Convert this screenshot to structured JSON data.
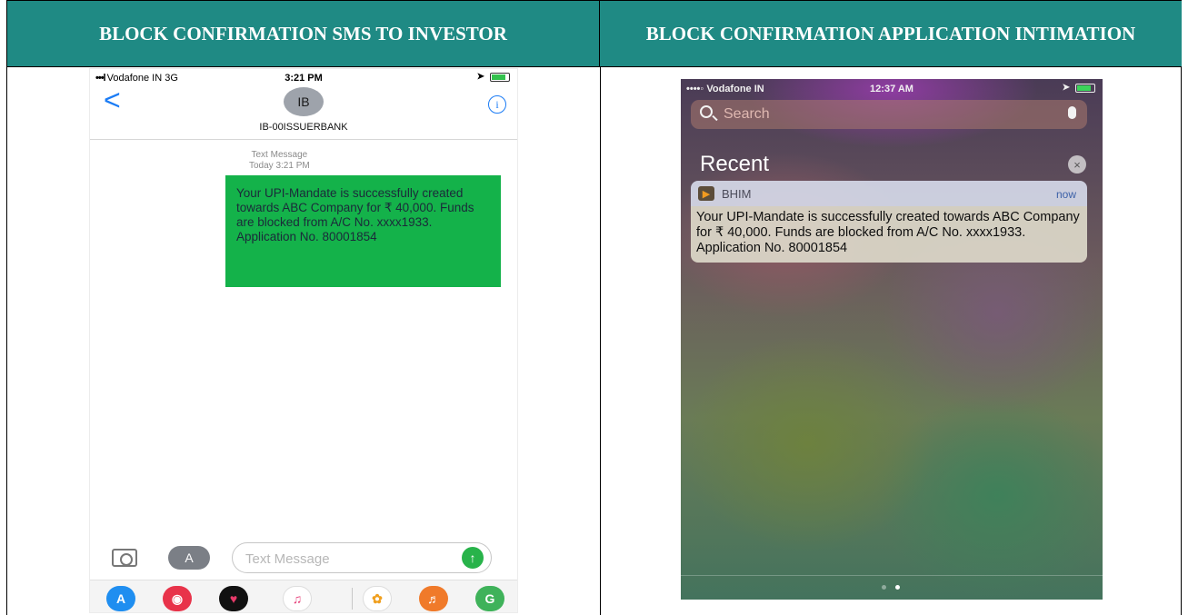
{
  "headers": {
    "left": "BLOCK CONFIRMATION SMS TO INVESTOR",
    "right": "BLOCK CONFIRMATION APPLICATION INTIMATION"
  },
  "sms_screen": {
    "status_bar": {
      "signal": "•••l",
      "carrier": "Vodafone IN  3G",
      "time": "3:21 PM"
    },
    "back_glyph": "<",
    "avatar_initials": "IB",
    "contact_name": "IB-00ISSUERBANK",
    "info_glyph": "i",
    "message_meta": "Text Message",
    "message_time": "Today 3:21 PM",
    "message_text": "Your UPI-Mandate is successfully created towards ABC Company for ₹ 40,000. Funds are blocked from A/C No. xxxx1933. Application No. 80001854",
    "composer_placeholder": "Text Message",
    "send_glyph": "↑",
    "app_store_glyph": "A"
  },
  "lock_screen": {
    "status_bar": {
      "carrier": "••••◦ Vodafone IN",
      "time": "12:37 AM"
    },
    "search_placeholder": "Search",
    "section_title": "Recent",
    "clear_glyph": "×",
    "notification": {
      "app": "BHIM",
      "time": "now",
      "body": "Your UPI-Mandate is successfully created towards ABC Company for ₹ 40,000. Funds are blocked from A/C No. xxxx1933. Application No. 80001854"
    }
  },
  "colors": {
    "header_bg": "#1f8a84",
    "sms_bubble": "#14b24a",
    "ios_blue": "#1b7cf5"
  }
}
